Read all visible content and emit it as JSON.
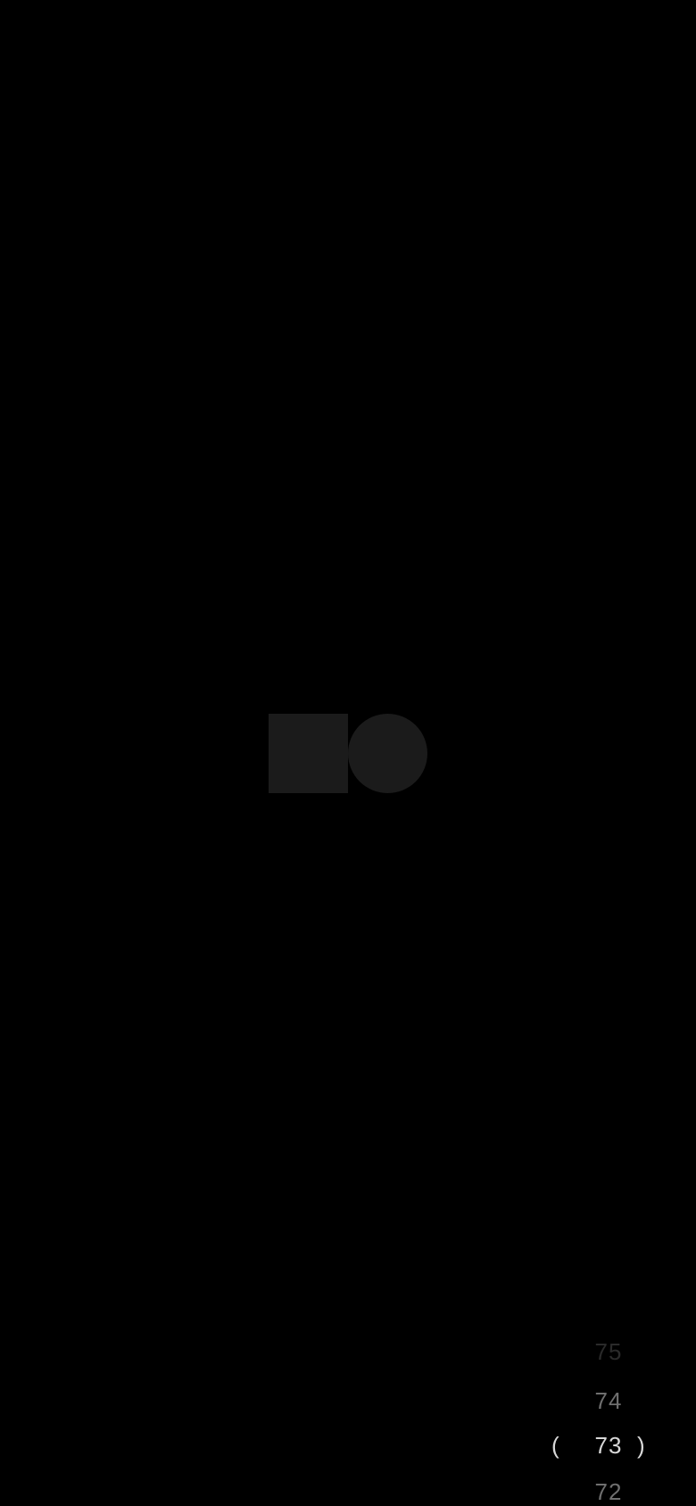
{
  "logo": {
    "icon": "square-circle-logo-icon",
    "color": "#1b1b1b"
  },
  "picker": {
    "items": {
      "previous2": "75",
      "previous1": "74",
      "selected": "73",
      "next1": "72"
    },
    "left_bracket": "(",
    "right_bracket": ")",
    "colors": {
      "selected": "#d8d8d8",
      "dim": "#6f6f6f",
      "faded": "#2a2a2a"
    }
  }
}
